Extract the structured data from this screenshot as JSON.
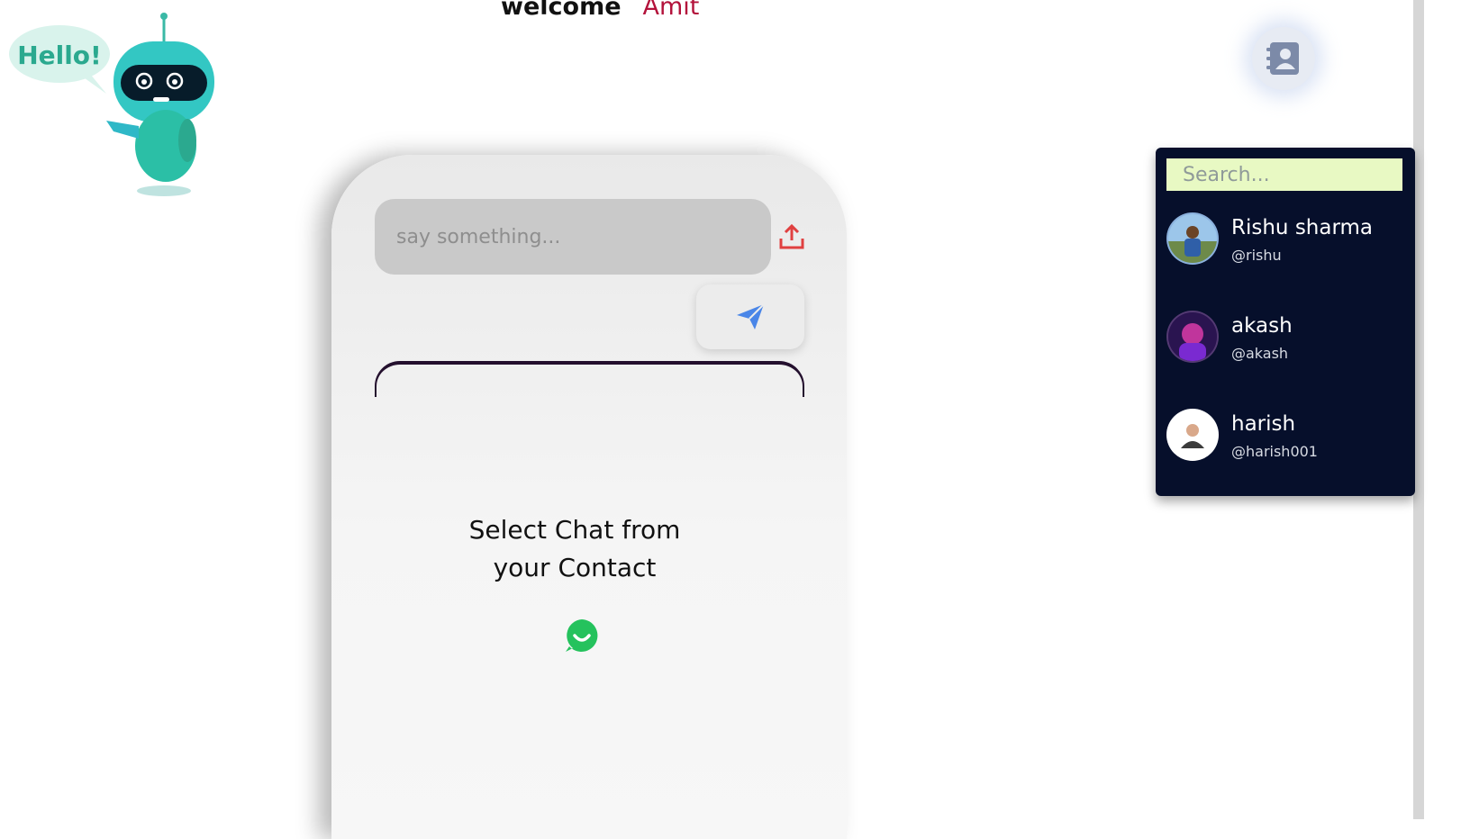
{
  "header": {
    "welcome_label": "welcome",
    "user_name": "Amit"
  },
  "mascot": {
    "greeting": "Hello!",
    "icon": "robot-mascot"
  },
  "toolbar": {
    "contacts_icon": "contacts-book-icon"
  },
  "chat": {
    "message_placeholder": "say something...",
    "upload_icon": "upload-icon",
    "send_icon": "paper-plane-icon",
    "empty_state": "Select Chat from your Contact",
    "empty_state_icon": "whatsapp-icon"
  },
  "contacts": {
    "search_placeholder": "Search...",
    "items": [
      {
        "name": "Rishu sharma",
        "handle": "@rishu"
      },
      {
        "name": "akash",
        "handle": "@akash"
      },
      {
        "name": "harish",
        "handle": "@harish001"
      }
    ]
  },
  "colors": {
    "accent_name": "#b3123b",
    "panel_bg": "#060f2b",
    "search_bg": "#e8f9c3",
    "upload_icon": "#e04040",
    "send_icon": "#4a86e8",
    "whatsapp": "#25c25d"
  }
}
